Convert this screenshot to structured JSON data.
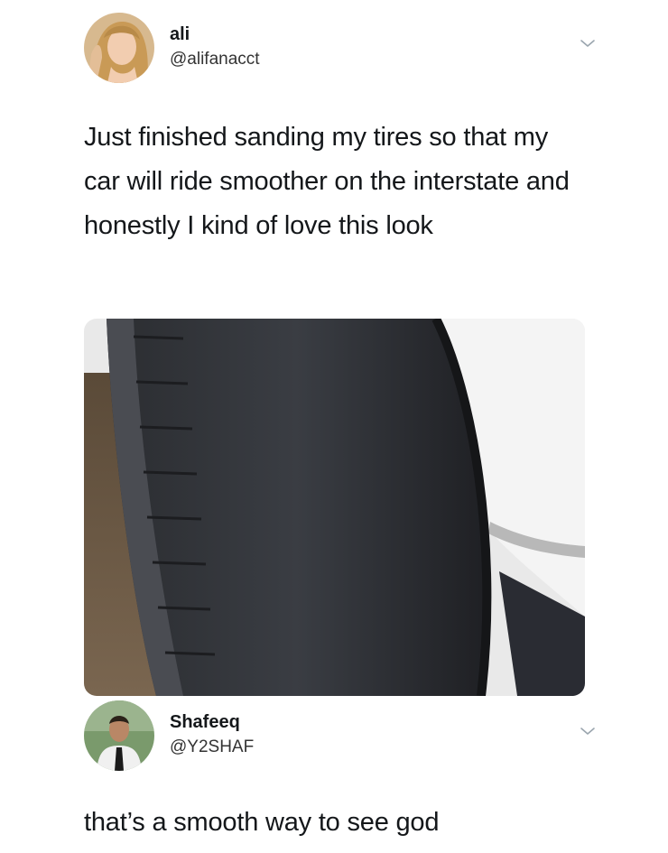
{
  "tweet": {
    "author": {
      "name": "ali",
      "handle": "@alifanacct",
      "avatar_icon": "avatar-blonde-woman"
    },
    "menu_icon": "chevron-down-icon",
    "text": "Just finished sanding my tires so that my car will ride smoother on the interstate and honestly I kind of love this look",
    "media_icon": "photo-worn-tire"
  },
  "reply": {
    "author": {
      "name": "Shafeeq",
      "handle": "@Y2SHAF",
      "avatar_icon": "avatar-man-suit"
    },
    "menu_icon": "chevron-down-icon",
    "text": "that’s a smooth way to see god"
  },
  "colors": {
    "text": "#14171a",
    "secondary": "#657786",
    "background": "#ffffff"
  }
}
